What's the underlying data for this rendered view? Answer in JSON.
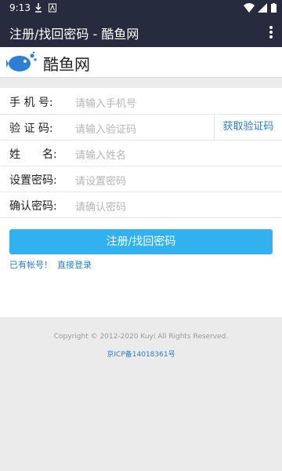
{
  "statusbar": {
    "time": "9:13"
  },
  "appbar": {
    "title": "注册/找回密码 - 酷鱼网"
  },
  "logo": {
    "text": "酷鱼网",
    "accent": "#2d7fd3"
  },
  "form": {
    "phone_label": "手 机 号:",
    "phone_placeholder": "请输入手机号",
    "code_label": "验 证 码:",
    "code_placeholder": "请输入验证码",
    "get_code": "获取验证码",
    "name_label": "姓　　名:",
    "name_placeholder": "请输入姓名",
    "setpwd_label": "设置密码:",
    "setpwd_placeholder": "请设置密码",
    "confirm_label": "确认密码:",
    "confirm_placeholder": "请确认密码",
    "submit": "注册/找回密码",
    "have_account": "已有帐号！",
    "login_link": "直接登录"
  },
  "footer": {
    "copyright": "Copyright © 2012-2020 Kuyi All Rights Reserved.",
    "icp": "京ICP备14018361号"
  },
  "colors": {
    "appbar": "#262b3e",
    "button": "#31b1ee",
    "link": "#2a7dc8"
  }
}
